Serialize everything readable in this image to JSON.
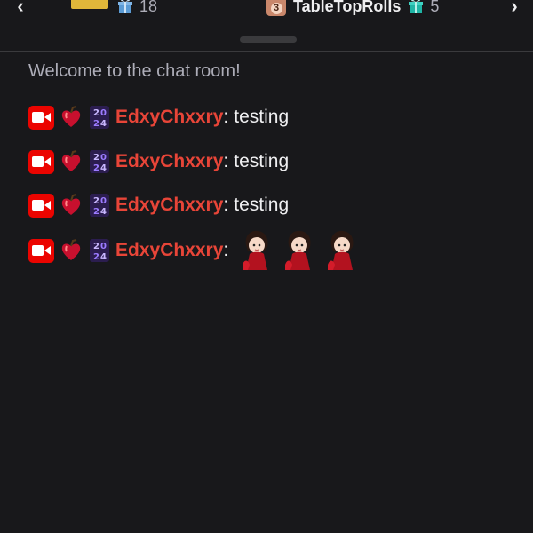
{
  "leaderboard": {
    "prev_icon": "chevron-left-icon",
    "next_icon": "chevron-right-icon",
    "entries": [
      {
        "rank_icon": "gold-rank-icon",
        "gift_icon": "gift-icon",
        "name": "",
        "gift_count": "18"
      },
      {
        "rank_icon": "rank-3-icon",
        "rank_number": "3",
        "gift_icon": "gift-icon",
        "name": "TableTopRolls",
        "gift_count": "5"
      }
    ]
  },
  "chat": {
    "welcome": "Welcome to the chat room!",
    "messages": [
      {
        "badges": [
          "live-broadcaster-badge",
          "heart-apple-badge",
          "2024-badge"
        ],
        "username": "EdxyChxxry",
        "text": "testing"
      },
      {
        "badges": [
          "live-broadcaster-badge",
          "heart-apple-badge",
          "2024-badge"
        ],
        "username": "EdxyChxxry",
        "text": "testing"
      },
      {
        "badges": [
          "live-broadcaster-badge",
          "heart-apple-badge",
          "2024-badge"
        ],
        "username": "EdxyChxxry",
        "text": "testing"
      },
      {
        "badges": [
          "live-broadcaster-badge",
          "heart-apple-badge",
          "2024-badge"
        ],
        "username": "EdxyChxxry",
        "emotes": [
          "girl-in-red-dress-emote",
          "girl-in-red-dress-emote",
          "girl-in-red-dress-emote"
        ]
      }
    ]
  },
  "colors": {
    "background": "#18181b",
    "username": "#e84538",
    "live_badge": "#eb0400",
    "muted_text": "#adadb8"
  }
}
